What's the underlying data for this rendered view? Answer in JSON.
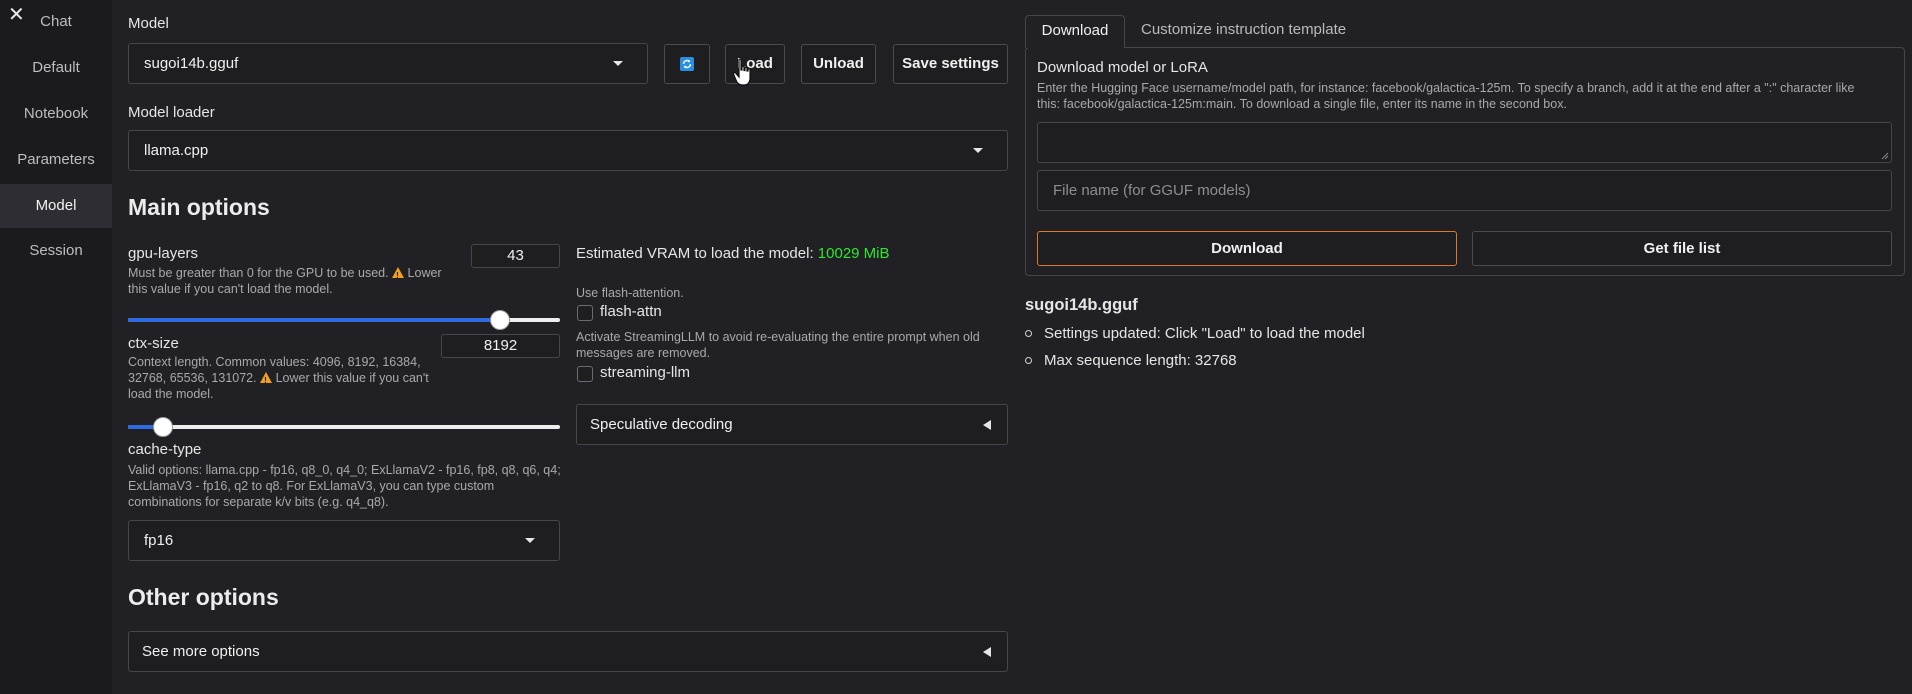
{
  "sidebar": {
    "close_glyph": "✕",
    "items": [
      {
        "label": "Chat"
      },
      {
        "label": "Default"
      },
      {
        "label": "Notebook"
      },
      {
        "label": "Parameters"
      },
      {
        "label": "Model",
        "active": true
      },
      {
        "label": "Session"
      }
    ]
  },
  "model": {
    "label": "Model",
    "selected": "sugoi14b.gguf",
    "refresh_icon": "refresh-icon",
    "load_label": "Load",
    "unload_label": "Unload",
    "save_label": "Save settings"
  },
  "loader": {
    "label": "Model loader",
    "selected": "llama.cpp"
  },
  "main_options": {
    "heading": "Main options",
    "gpu_layers": {
      "label": "gpu-layers",
      "hint_a": "Must be greater than 0 for the GPU to be used.",
      "hint_b": "Lower",
      "hint_c": "this value if you can't load the model.",
      "value": "43",
      "slider_fraction": 0.86
    },
    "ctx_size": {
      "label": "ctx-size",
      "hint_line1": "Context length. Common values: 4096, 8192, 16384,",
      "hint_line2a": "32768, 65536, 131072.",
      "hint_line2b": "Lower this value if you can't",
      "hint_line3": "load the model.",
      "value": "8192",
      "slider_fraction": 0.08
    },
    "cache_type": {
      "label": "cache-type",
      "hint_line1": "Valid options: llama.cpp - fp16, q8_0, q4_0; ExLlamaV2 - fp16, fp8, q8, q6, q4;",
      "hint_line2": "ExLlamaV3 - fp16, q2 to q8. For ExLlamaV3, you can type custom",
      "hint_line3": "combinations for separate k/v bits (e.g. q4_q8).",
      "selected": "fp16"
    },
    "vram": {
      "label": "Estimated VRAM to load the model:",
      "value": "10029 MiB",
      "value_color": "#2ee62e"
    },
    "flash_attn": {
      "hint": "Use flash-attention.",
      "label": "flash-attn",
      "checked": false
    },
    "streaming_llm": {
      "hint_line1": "Activate StreamingLLM to avoid re-evaluating the entire prompt when old",
      "hint_line2": "messages are removed.",
      "label": "streaming-llm",
      "checked": false
    },
    "speculative": {
      "label": "Speculative decoding"
    }
  },
  "other_options": {
    "heading": "Other options",
    "see_more": "See more options"
  },
  "right": {
    "tabs": [
      {
        "label": "Download",
        "active": true
      },
      {
        "label": "Customize instruction template",
        "active": false
      }
    ],
    "download_heading": "Download model or LoRA",
    "download_hint_line1": "Enter the Hugging Face username/model path, for instance: facebook/galactica-125m. To specify a branch, add it at the end after a \":\" character like",
    "download_hint_line2": "this: facebook/galactica-125m:main. To download a single file, enter its name in the second box.",
    "repo_value": "",
    "file_placeholder": "File name (for GGUF models)",
    "download_button": "Download",
    "file_list_button": "Get file list",
    "status_title": "sugoi14b.gguf",
    "status_items": [
      "Settings updated: Click \"Load\" to load the model",
      "Max sequence length: 32768"
    ],
    "accent_color": "#e2762a"
  }
}
